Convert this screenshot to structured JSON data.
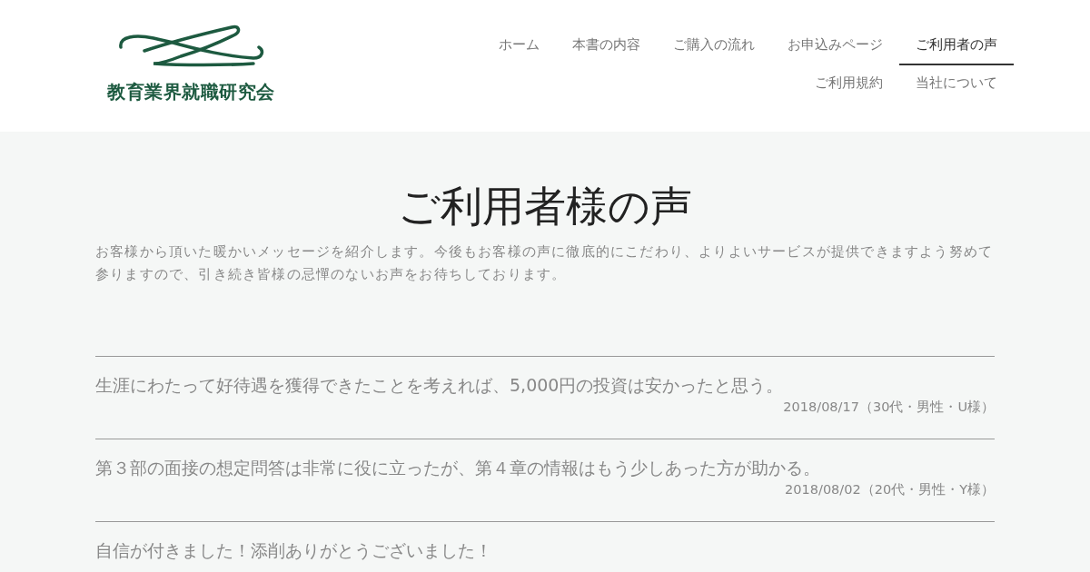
{
  "logo": {
    "text": "教育業界就職研究会"
  },
  "nav": [
    {
      "label": "ホーム",
      "selected": false
    },
    {
      "label": "本書の内容",
      "selected": false
    },
    {
      "label": "ご購入の流れ",
      "selected": false
    },
    {
      "label": "お申込みページ",
      "selected": false
    },
    {
      "label": "ご利用者の声",
      "selected": true
    },
    {
      "label": "ご利用規約",
      "selected": false
    },
    {
      "label": "当社について",
      "selected": false
    }
  ],
  "page": {
    "title": "ご利用者様の声",
    "intro": "お客様から頂いた暖かいメッセージを紹介します。今後もお客様の声に徹底的にこだわり、よりよいサービスが提供できますよう努めて参りますので、引き続き皆様の忌憚のないお声をお待ちしております。"
  },
  "testimonials": [
    {
      "quote": "生涯にわたって好待遇を獲得できたことを考えれば、5,000円の投資は安かったと思う。",
      "meta": "2018/08/17（30代・男性・U様）"
    },
    {
      "quote": "第３部の面接の想定問答は非常に役に立ったが、第４章の情報はもう少しあった方が助かる。",
      "meta": "2018/08/02（20代・男性・Y様）"
    },
    {
      "quote": "自信が付きました！添削ありがとうございました！"
    }
  ]
}
